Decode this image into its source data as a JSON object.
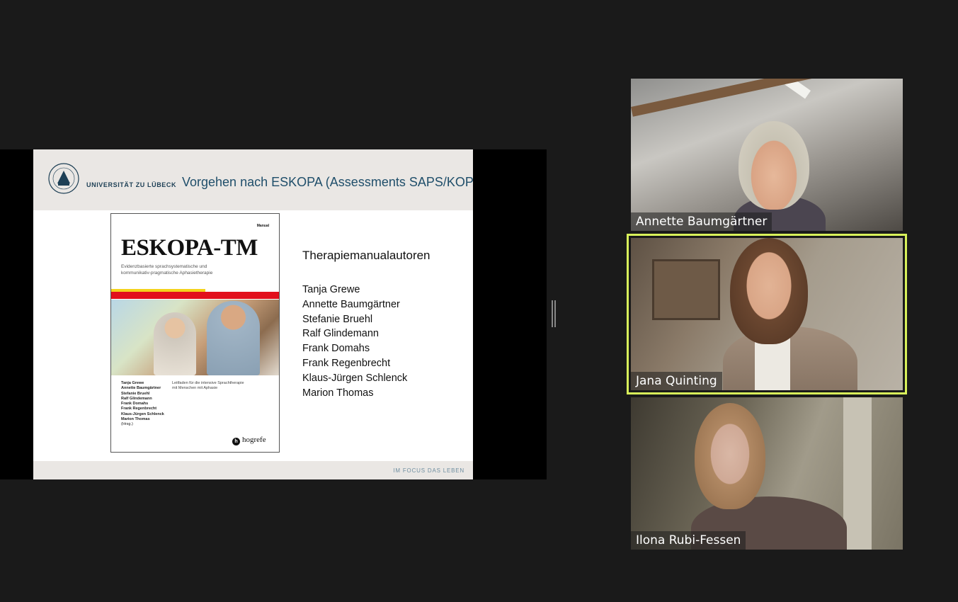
{
  "slide": {
    "university": "UNIVERSITÄT ZU LÜBECK",
    "title": "Vorgehen nach ESKOPA (Assessments SAPS/KOPS)",
    "footer": "IM FOCUS DAS LEBEN",
    "book": {
      "manual_label": "Manual",
      "title": "ESKOPA-TM",
      "subtitle_line1": "Evidenzbasierte sprachsystematische und",
      "subtitle_line2": "kommunikativ-pragmatische Aphasietherapie",
      "authors": [
        "Tanja Grewe",
        "Annette Baumgärtner",
        "Stefanie Bruehl",
        "Ralf Glindemann",
        "Frank Domahs",
        "Frank Regenbrecht",
        "Klaus-Jürgen Schlenck",
        "Marion Thomas"
      ],
      "hrsg": "(Hrsg.)",
      "tagline_line1": "Leitfaden für die intensive Sprachtherapie",
      "tagline_line2": "mit Menschen mit Aphasie",
      "publisher": "hogrefe",
      "publisher_logo_letter": "h"
    },
    "authors_heading": "Therapiemanualautoren",
    "authors": [
      "Tanja Grewe",
      "Annette Baumgärtner",
      "Stefanie Bruehl",
      "Ralf Glindemann",
      "Frank Domahs",
      "Frank Regenbrecht",
      "Klaus-Jürgen Schlenck",
      "Marion Thomas"
    ]
  },
  "participants": [
    {
      "name": "Annette Baumgärtner",
      "active": false
    },
    {
      "name": "Jana Quinting",
      "active": true
    },
    {
      "name": "Ilona Rubi-Fessen",
      "active": false
    }
  ],
  "colors": {
    "background": "#1a1a1a",
    "active_speaker_border": "#d8f15a",
    "slide_title": "#1f4e6a"
  }
}
